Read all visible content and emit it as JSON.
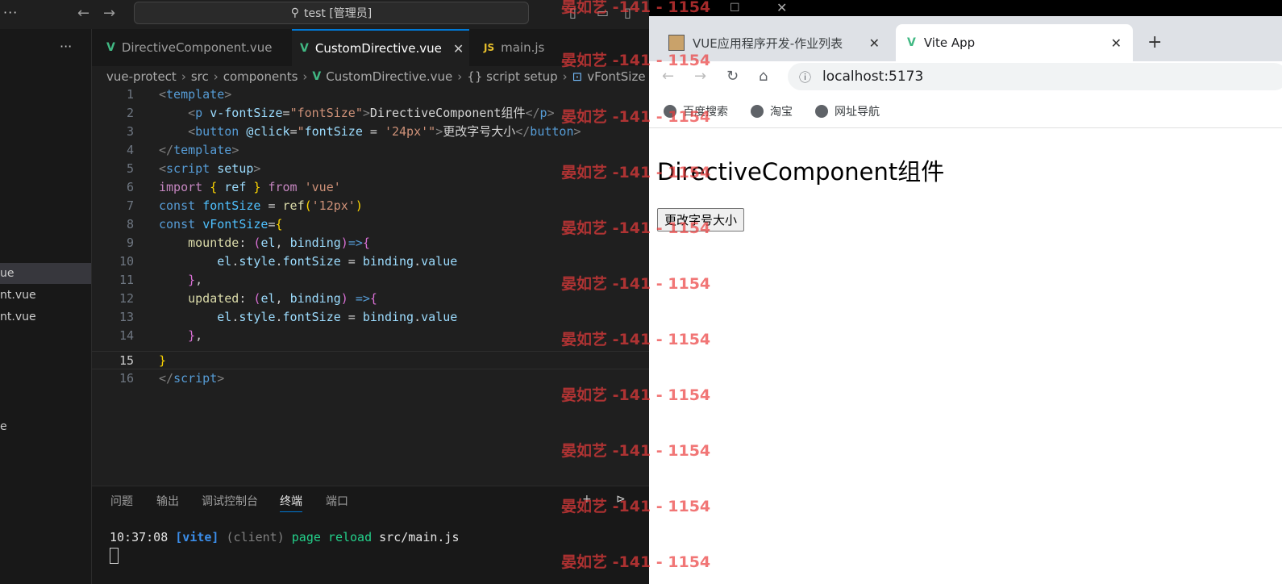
{
  "vscode": {
    "title_search": "test [管理员]",
    "sidebar_items": [
      "ue",
      "nt.vue",
      "nt.vue",
      "e"
    ],
    "tabs": [
      {
        "label": "DirectiveComponent.vue",
        "icon": "vue-icon"
      },
      {
        "label": "CustomDirective.vue",
        "icon": "vue-icon",
        "active": true
      },
      {
        "label": "main.js",
        "icon": "js-icon"
      }
    ],
    "breadcrumb": [
      "vue-protect",
      "src",
      "components",
      "CustomDirective.vue",
      "{} script setup",
      "vFontSize"
    ],
    "line_numbers": [
      "1",
      "2",
      "3",
      "4",
      "5",
      "6",
      "7",
      "8",
      "9",
      "10",
      "11",
      "12",
      "13",
      "14",
      "15",
      "16"
    ],
    "current_line": 15,
    "panel_tabs": [
      "问题",
      "输出",
      "调试控制台",
      "终端",
      "端口"
    ],
    "terminal": {
      "time": "10:37:08",
      "tag": "[vite]",
      "client": "(client)",
      "message": "page reload",
      "file": "src/main.js"
    }
  },
  "browser": {
    "tabs": [
      {
        "title": "VUE应用程序开发-作业列表"
      },
      {
        "title": "Vite App",
        "active": true
      }
    ],
    "address": "localhost:5173",
    "bookmarks": [
      "百度搜索",
      "淘宝",
      "网址导航"
    ],
    "page": {
      "heading": "DirectiveComponent组件",
      "button": "更改字号大小"
    }
  },
  "watermark": "晏如艺 -141 - 1154"
}
